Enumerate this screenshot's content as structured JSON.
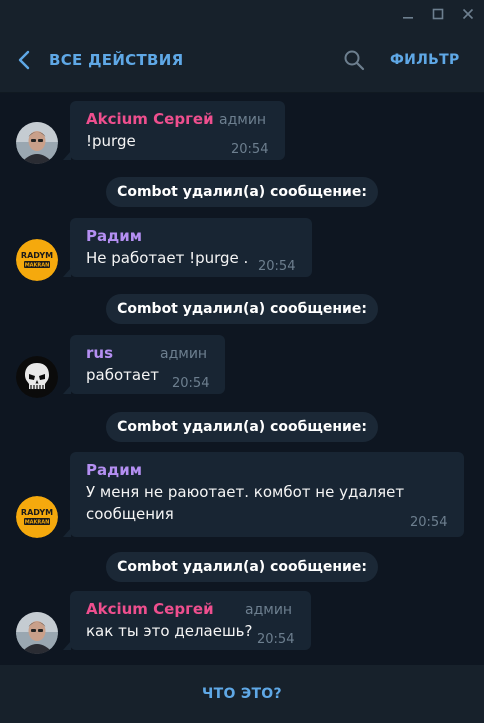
{
  "colors": {
    "background": "#0e1621",
    "panel": "#17212b",
    "bubble": "#182533",
    "accent": "#5fa8e6",
    "name_pink": "#ee4f8e",
    "name_purple": "#b48ff2",
    "muted": "#6d7f8f"
  },
  "window_controls": {
    "minimize_icon": "minimize-icon",
    "maximize_icon": "maximize-icon",
    "close_icon": "close-icon"
  },
  "header": {
    "back_icon": "chevron-left-icon",
    "title": "ВСЕ ДЕЙСТВИЯ",
    "search_icon": "search-icon",
    "filter_label": "ФИЛЬТР"
  },
  "messages": [
    {
      "sender": "Akcium Сергей",
      "role": "админ",
      "text": "!purge",
      "time": "20:54",
      "avatar": "photo-avatar"
    },
    {
      "sender": "Радим",
      "role": "",
      "text": "Не работает !purge .",
      "time": "20:54",
      "avatar": "radym-logo-avatar"
    },
    {
      "sender": "rus",
      "role": "админ",
      "text": "работает",
      "time": "20:54",
      "avatar": "skull-avatar"
    },
    {
      "sender": "Радим",
      "role": "",
      "text": "У меня не раюотает. комбот не удаляет сообщения",
      "time": "20:54",
      "avatar": "radym-logo-avatar"
    },
    {
      "sender": "Akcium Сергей",
      "role": "админ",
      "text": "как ты это делаешь?",
      "time": "20:54",
      "avatar": "photo-avatar"
    }
  ],
  "service_messages": [
    "Combot удалил(а) сообщение:",
    "Combot удалил(а) сообщение:",
    "Combot удалил(а) сообщение:",
    "Combot удалил(а) сообщение:"
  ],
  "footer": {
    "help_label": "ЧТО ЭТО?"
  }
}
